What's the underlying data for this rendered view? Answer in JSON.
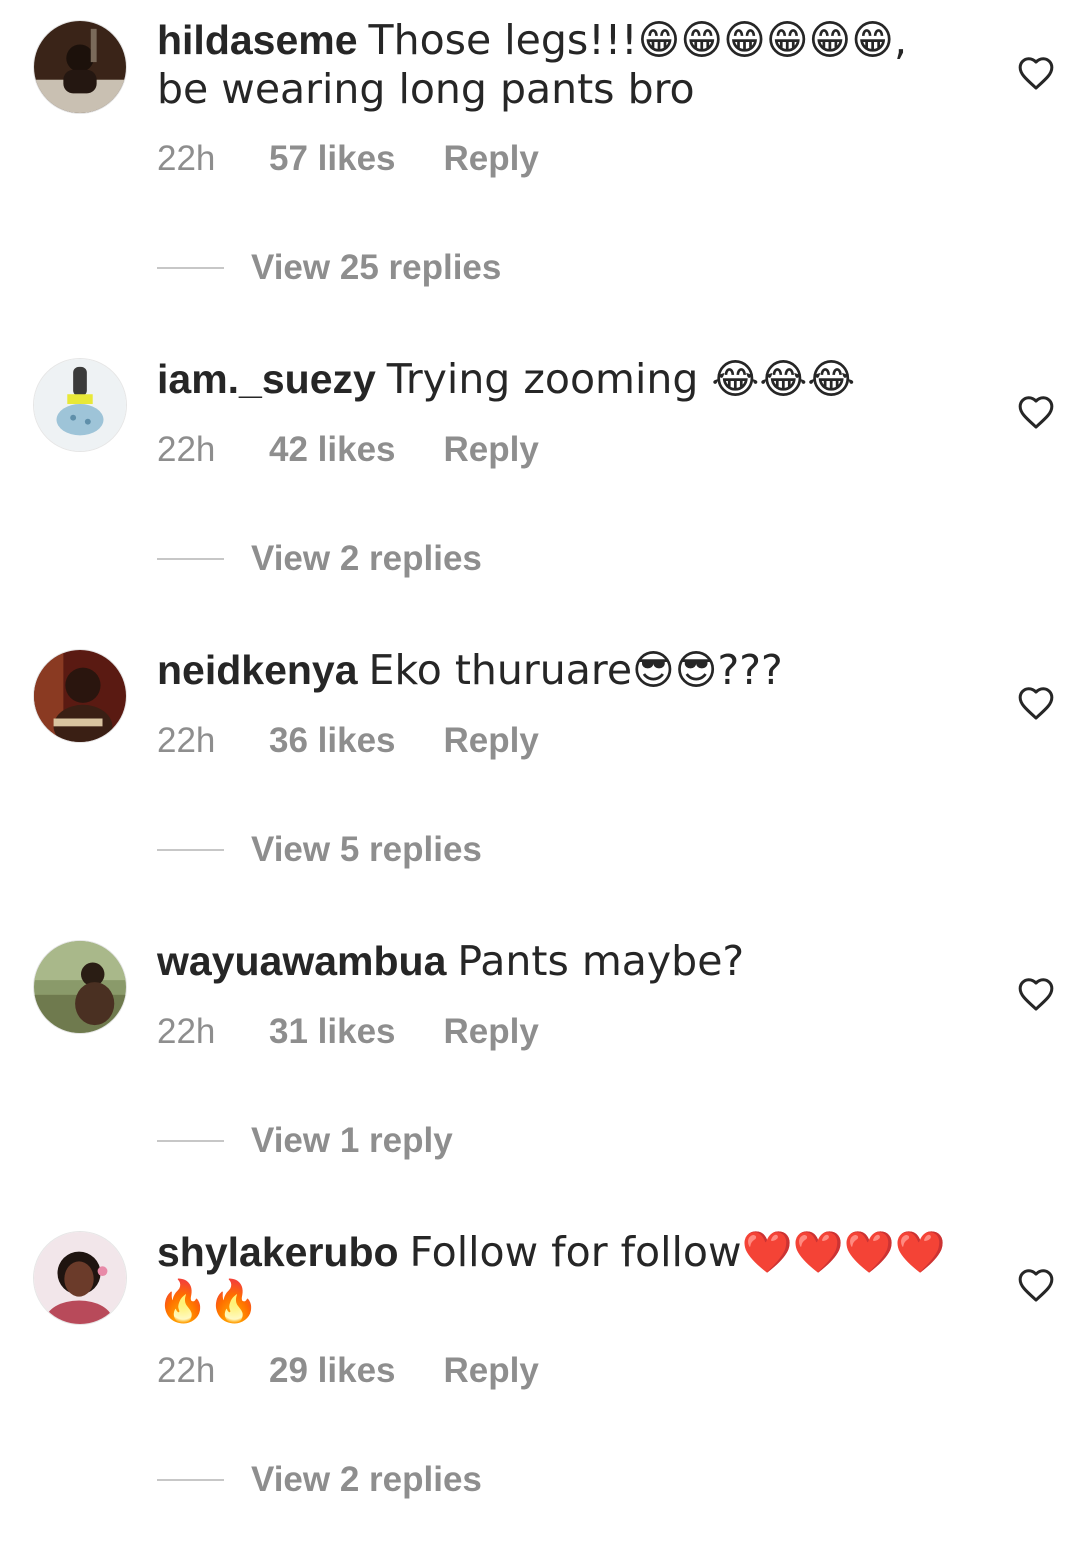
{
  "comments": [
    {
      "username": "hildaseme",
      "text": "Those legs!!!😁😁😁😁😁😁, be wearing long pants bro",
      "time": "22h",
      "likes": "57 likes",
      "reply_label": "Reply",
      "view_replies": "View 25 replies",
      "avatar_color": "#3a2418"
    },
    {
      "username": "iam._suezy",
      "text": "Trying zooming 😂😂😂",
      "time": "22h",
      "likes": "42 likes",
      "reply_label": "Reply",
      "view_replies": "View 2 replies",
      "avatar_color": "#d9dfe4"
    },
    {
      "username": "neidkenya",
      "text": "Eko thuruare😎😎???",
      "time": "22h",
      "likes": "36 likes",
      "reply_label": "Reply",
      "view_replies": "View 5 replies",
      "avatar_color": "#5a1a12"
    },
    {
      "username": "wayuawambua",
      "text": "Pants maybe?",
      "time": "22h",
      "likes": "31 likes",
      "reply_label": "Reply",
      "view_replies": "View 1 reply",
      "avatar_color": "#6e7a52"
    },
    {
      "username": "shylakerubo",
      "text": "Follow for follow❤️❤️❤️❤️🔥🔥",
      "time": "22h",
      "likes": "29 likes",
      "reply_label": "Reply",
      "view_replies": "View 2 replies",
      "avatar_color": "#b84a5a"
    }
  ],
  "icons": {
    "like": "heart-outline-icon"
  },
  "colors": {
    "text": "#262626",
    "secondary": "#8e8e8e",
    "divider": "#c7c7c7"
  }
}
